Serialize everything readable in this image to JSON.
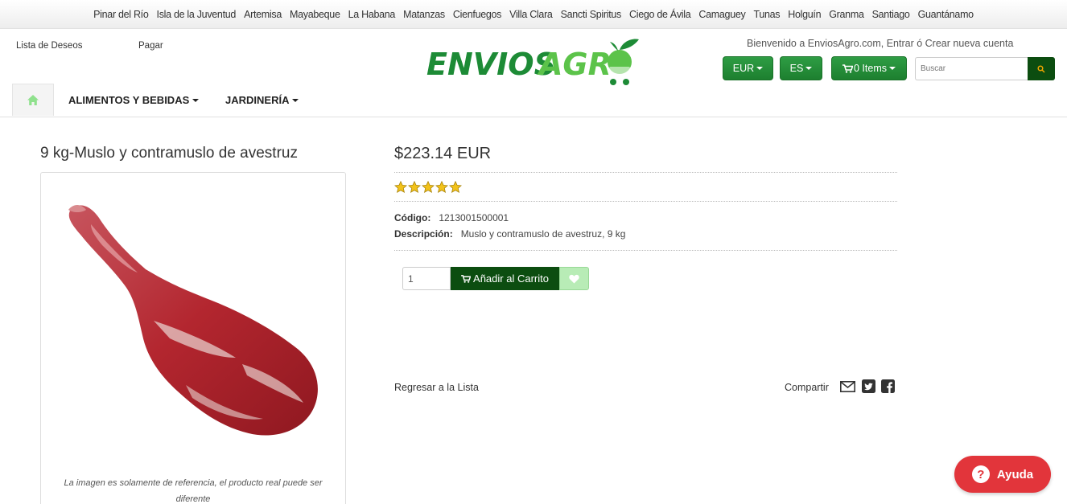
{
  "provinces": [
    "Pinar del Río",
    "Isla de la Juventud",
    "Artemisa",
    "Mayabeque",
    "La Habana",
    "Matanzas",
    "Cienfuegos",
    "Villa Clara",
    "Sancti Spiritus",
    "Ciego de Ávila",
    "Camaguey",
    "Tunas",
    "Holguín",
    "Granma",
    "Santiago",
    "Guantánamo"
  ],
  "header": {
    "wishlist_label": "Lista de Deseos",
    "pay_label": "Pagar",
    "logo_text_dark": "ENVIOS",
    "logo_text_light": "AGR",
    "welcome": "Bienvenido a EnviosAgro.com, Entrar ó Crear nueva cuenta",
    "currency": "EUR",
    "language": "ES",
    "cart_label": "0 Items",
    "search_placeholder": "Buscar"
  },
  "nav": {
    "items": [
      {
        "label": "ALIMENTOS Y BEBIDAS"
      },
      {
        "label": "JARDINERÍA"
      }
    ]
  },
  "product": {
    "title": "9 kg-Muslo y contramuslo de avestruz",
    "price": "$223.14 EUR",
    "rating_stars": 5,
    "code_label": "Código:",
    "code_value": "1213001500001",
    "desc_label": "Descripción:",
    "desc_value": "Muslo y contramuslo de avestruz, 9 kg",
    "quantity": "1",
    "add_to_cart_label": "Añadir al Carrito",
    "image_caption": "La imagen es solamente de referencia, el producto real puede ser diferente"
  },
  "footer_links": {
    "back_label": "Regresar a la Lista",
    "share_label": "Compartir"
  },
  "help": {
    "label": "Ayuda"
  },
  "colors": {
    "brand_green": "#2e9d44",
    "dark_green": "#0c4d10",
    "help_red": "#e2353b",
    "wish_light_green": "#b8ecb6"
  }
}
